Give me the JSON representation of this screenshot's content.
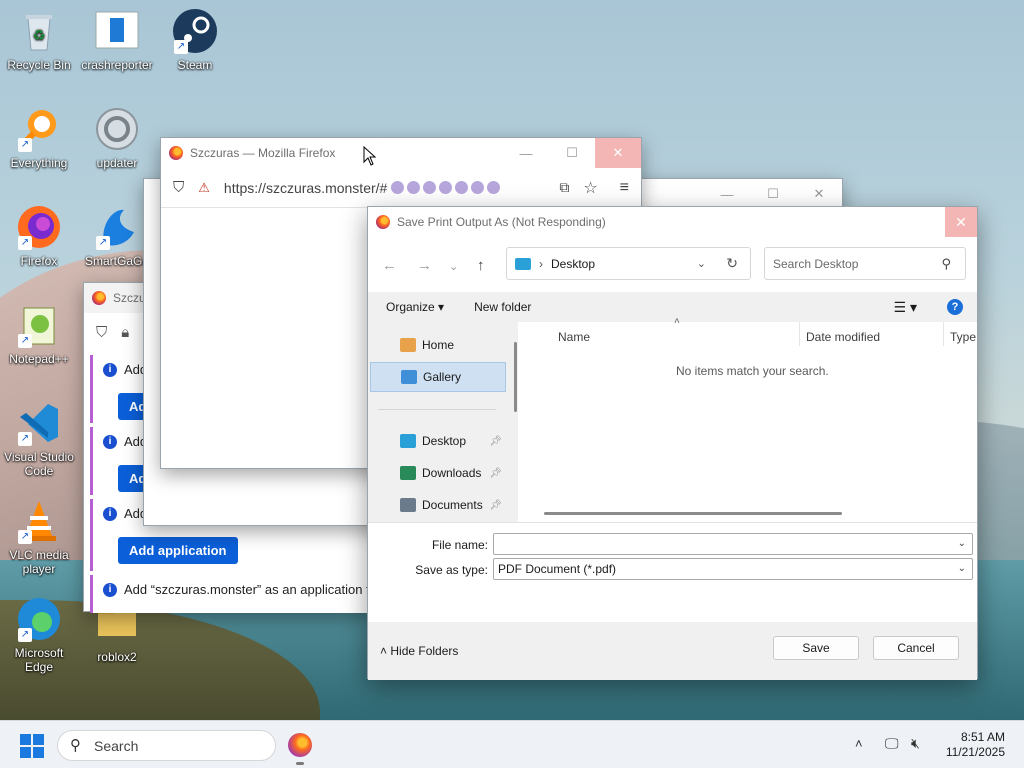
{
  "desktop": {
    "icons": [
      {
        "label": "Recycle Bin",
        "icon": "recycle-bin-icon"
      },
      {
        "label": "crashreporter",
        "icon": "crashreporter-icon"
      },
      {
        "label": "Steam",
        "icon": "steam-icon"
      },
      {
        "label": "Everything",
        "icon": "everything-search-icon"
      },
      {
        "label": "updater",
        "icon": "updater-icon"
      },
      {
        "label": "Firefox",
        "icon": "firefox-icon"
      },
      {
        "label": "SmartGaGa",
        "icon": "smartgaga-icon"
      },
      {
        "label": "Notepad++",
        "icon": "notepadpp-icon"
      },
      {
        "label": "Visual Studio Code",
        "icon": "vscode-icon"
      },
      {
        "label": "VLC media player",
        "icon": "vlc-icon"
      },
      {
        "label": "Microsoft Edge",
        "icon": "edge-icon"
      },
      {
        "label": "roblox2",
        "icon": "folder-icon"
      }
    ]
  },
  "firefox_front": {
    "title": "Szczuras — Mozilla Firefox",
    "url": "https://szczuras.monster/#"
  },
  "firefox_back": {
    "tab_title": "Szczu",
    "notifications": [
      {
        "text": "Add",
        "button": "Add"
      },
      {
        "text": "Add",
        "button": "Add"
      },
      {
        "text": "Add",
        "button": "Add application"
      },
      {
        "text": "Add “szczuras.monster” as an application for irc"
      }
    ]
  },
  "dialog": {
    "title": "Save Print Output As (Not Responding)",
    "location": "Desktop",
    "search_placeholder": "Search Desktop",
    "organize_label": "Organize",
    "new_folder_label": "New folder",
    "nav": {
      "home": "Home",
      "gallery": "Gallery",
      "desktop": "Desktop",
      "downloads": "Downloads",
      "documents": "Documents"
    },
    "columns": {
      "name": "Name",
      "date": "Date modified",
      "type": "Type"
    },
    "empty_message": "No items match your search.",
    "file_name_label": "File name:",
    "file_name_value": "",
    "save_type_label": "Save as type:",
    "save_type_value": "PDF Document (*.pdf)",
    "hide_folders": "Hide Folders",
    "save_button": "Save",
    "cancel_button": "Cancel",
    "colors": {
      "close": "#f4b6b4",
      "selected": "#cfe0f2"
    }
  },
  "taskbar": {
    "search_label": "Search",
    "time": "8:51 AM",
    "date": "11/21/2025"
  }
}
